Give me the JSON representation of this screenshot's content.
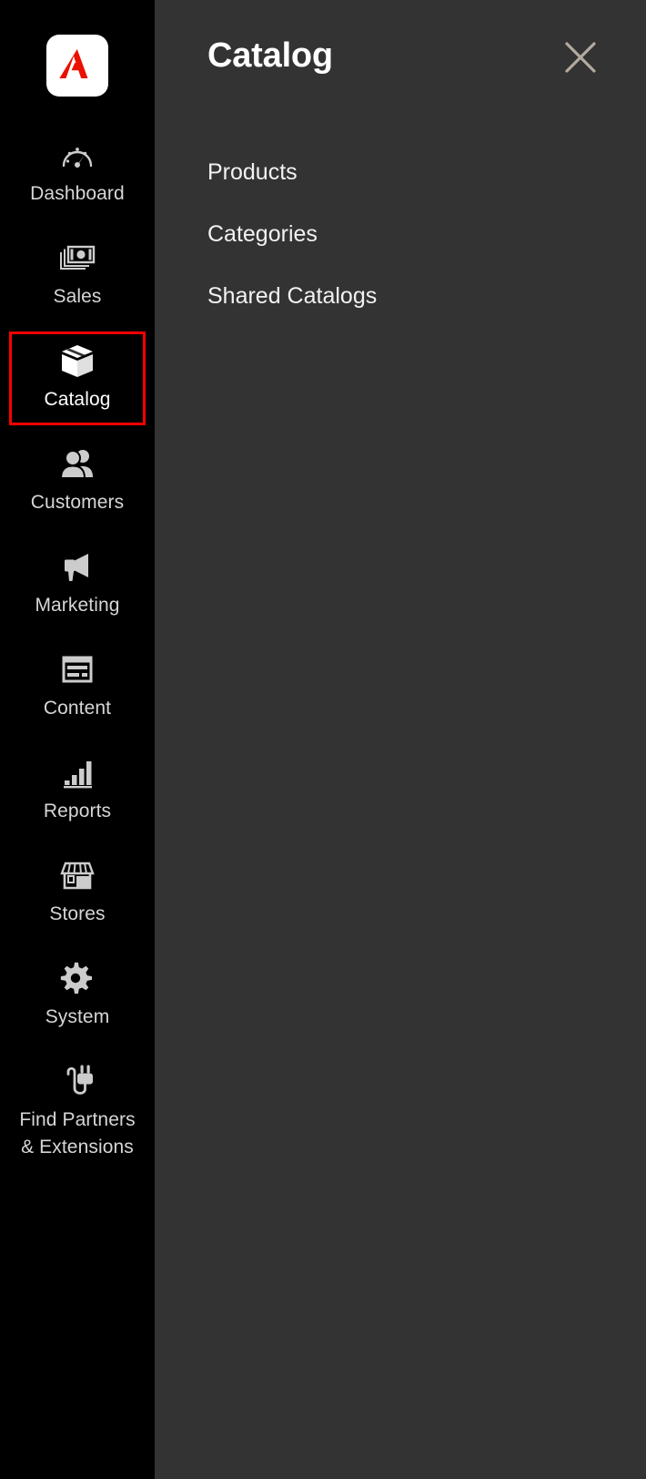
{
  "colors": {
    "sidebar_bg": "#000000",
    "panel_bg": "#333333",
    "accent_red": "#ff0000",
    "logo_red": "#eb1000",
    "icon_gray": "#cccccc",
    "label_gray": "#d6d6d6",
    "close_icon": "#b3aaa0"
  },
  "sidebar": {
    "logo": {
      "icon": "adobe-logo-icon",
      "alt": "Adobe"
    },
    "items": [
      {
        "id": "dashboard",
        "label": "Dashboard",
        "icon": "gauge-icon",
        "highlighted": false
      },
      {
        "id": "sales",
        "label": "Sales",
        "icon": "money-icon",
        "highlighted": false
      },
      {
        "id": "catalog",
        "label": "Catalog",
        "icon": "box-icon",
        "highlighted": true
      },
      {
        "id": "customers",
        "label": "Customers",
        "icon": "users-icon",
        "highlighted": false
      },
      {
        "id": "marketing",
        "label": "Marketing",
        "icon": "megaphone-icon",
        "highlighted": false
      },
      {
        "id": "content",
        "label": "Content",
        "icon": "window-icon",
        "highlighted": false
      },
      {
        "id": "reports",
        "label": "Reports",
        "icon": "bar-chart-icon",
        "highlighted": false
      },
      {
        "id": "stores",
        "label": "Stores",
        "icon": "storefront-icon",
        "highlighted": false
      },
      {
        "id": "system",
        "label": "System",
        "icon": "gear-icon",
        "highlighted": false
      },
      {
        "id": "find-partners",
        "label": "Find Partners\n& Extensions",
        "icon": "plug-icon",
        "highlighted": false
      }
    ]
  },
  "panel": {
    "title": "Catalog",
    "close_icon": "close-icon",
    "menu_items": [
      {
        "id": "products",
        "label": "Products"
      },
      {
        "id": "categories",
        "label": "Categories"
      },
      {
        "id": "shared-catalogs",
        "label": "Shared Catalogs"
      }
    ]
  }
}
